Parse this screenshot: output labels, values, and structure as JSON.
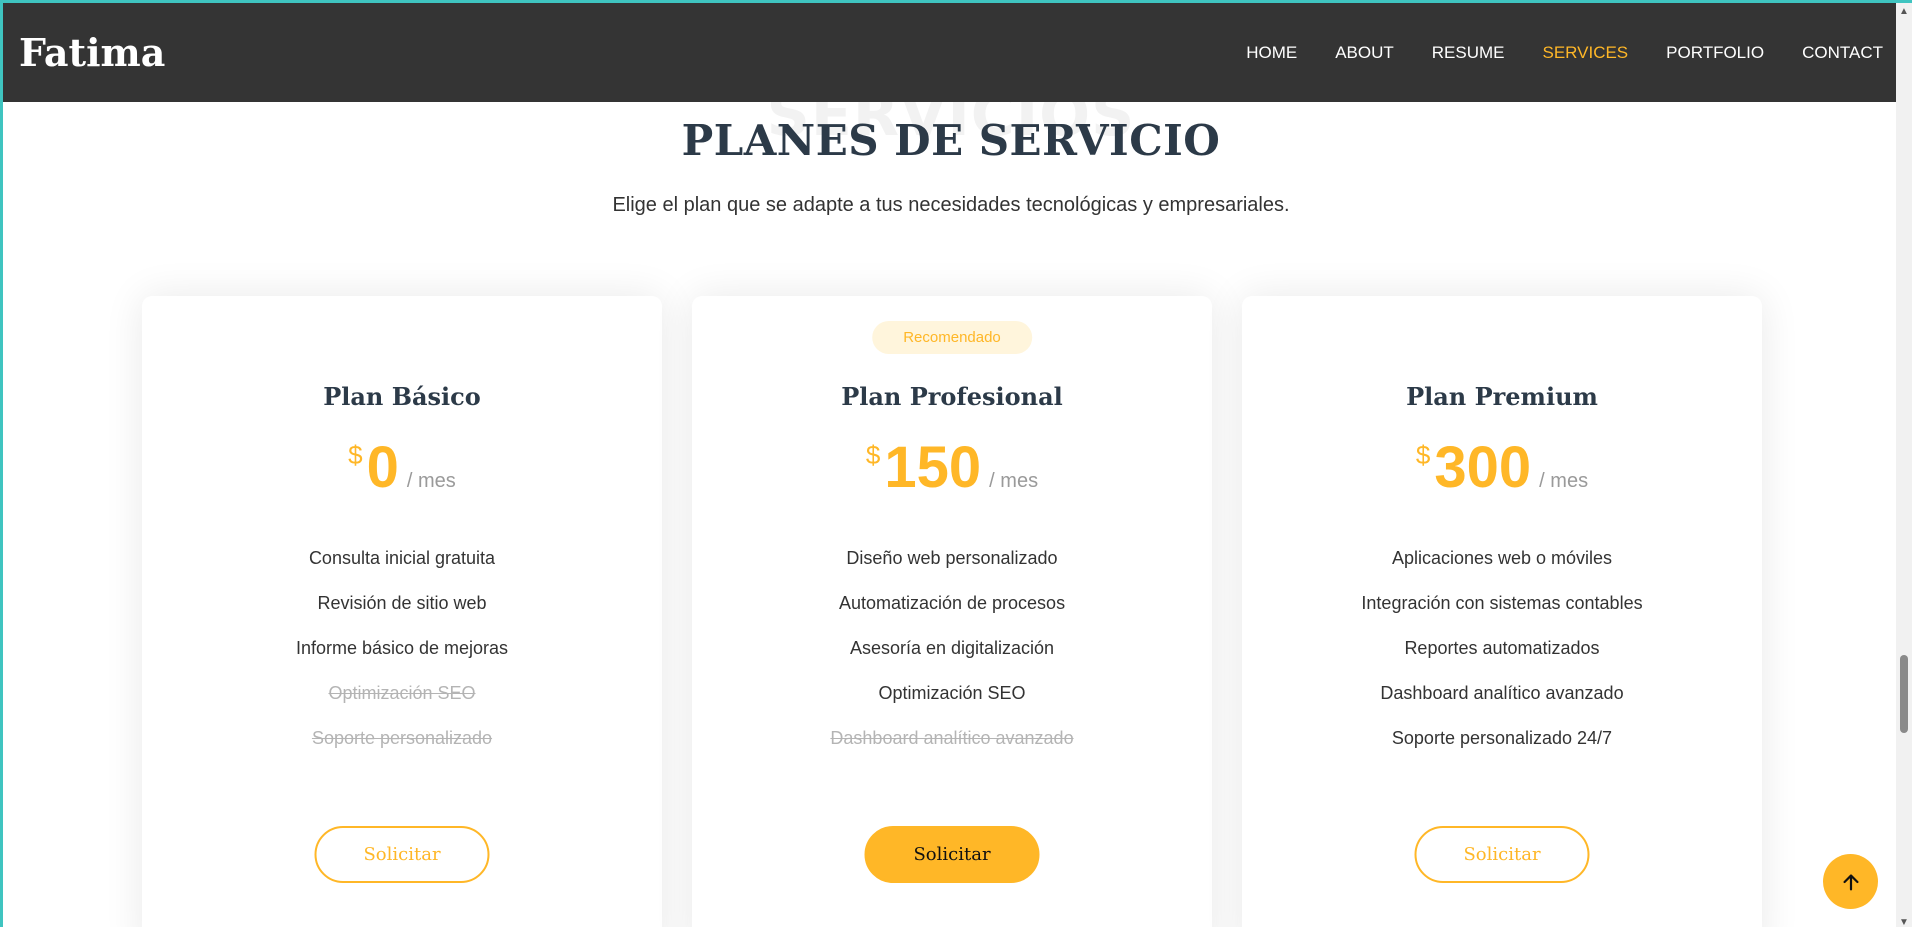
{
  "header": {
    "logo": "Fatima",
    "nav": [
      {
        "label": "HOME",
        "active": false
      },
      {
        "label": "ABOUT",
        "active": false
      },
      {
        "label": "RESUME",
        "active": false
      },
      {
        "label": "SERVICES",
        "active": true
      },
      {
        "label": "PORTFOLIO",
        "active": false
      },
      {
        "label": "CONTACT",
        "active": false
      }
    ]
  },
  "section": {
    "bg_title": "SERVICIOS",
    "title": "PLANES DE SERVICIO",
    "subtitle": "Elige el plan que se adapte a tus necesidades tecnológicas y empresariales."
  },
  "plans": [
    {
      "name": "Plan Básico",
      "currency": "$",
      "amount": "0",
      "period": "/ mes",
      "badge": null,
      "features": [
        {
          "text": "Consulta inicial gratuita",
          "included": true
        },
        {
          "text": "Revisión de sitio web",
          "included": true
        },
        {
          "text": "Informe básico de mejoras",
          "included": true
        },
        {
          "text": "Optimización SEO",
          "included": false
        },
        {
          "text": "Soporte personalizado",
          "included": false
        }
      ],
      "button": "Solicitar",
      "featured": false
    },
    {
      "name": "Plan Profesional",
      "currency": "$",
      "amount": "150",
      "period": "/ mes",
      "badge": "Recomendado",
      "features": [
        {
          "text": "Diseño web personalizado",
          "included": true
        },
        {
          "text": "Automatización de procesos",
          "included": true
        },
        {
          "text": "Asesoría en digitalización",
          "included": true
        },
        {
          "text": "Optimización SEO",
          "included": true
        },
        {
          "text": "Dashboard analítico avanzado",
          "included": false
        }
      ],
      "button": "Solicitar",
      "featured": true
    },
    {
      "name": "Plan Premium",
      "currency": "$",
      "amount": "300",
      "period": "/ mes",
      "badge": null,
      "features": [
        {
          "text": "Aplicaciones web o móviles",
          "included": true
        },
        {
          "text": "Integración con sistemas contables",
          "included": true
        },
        {
          "text": "Reportes automatizados",
          "included": true
        },
        {
          "text": "Dashboard analítico avanzado",
          "included": true
        },
        {
          "text": "Soporte personalizado 24/7",
          "included": true
        }
      ],
      "button": "Solicitar",
      "featured": false
    }
  ],
  "colors": {
    "accent": "#ffb727",
    "header_bg": "#343434",
    "title": "#2c3a48"
  },
  "icons": {
    "back_to_top": "arrow-up-icon"
  }
}
